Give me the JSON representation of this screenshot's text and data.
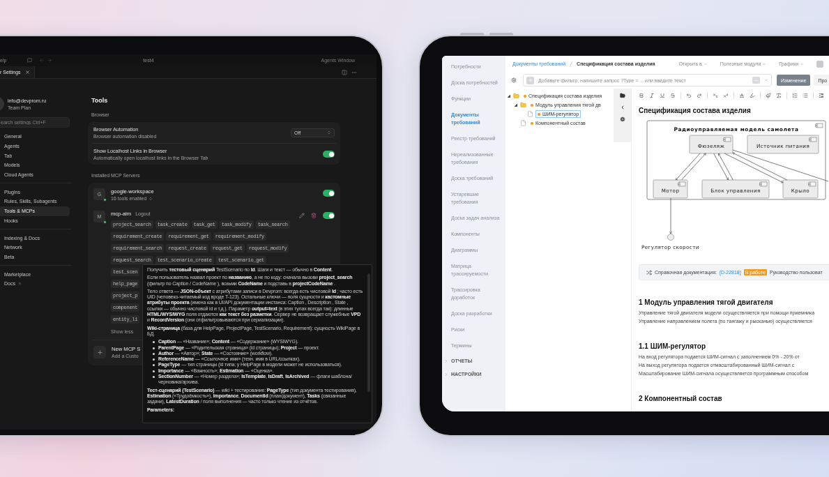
{
  "left_tablet": {
    "title_bar": {
      "menu": "elp",
      "title": "test4",
      "right_label": "Agents Window"
    },
    "tabs": [
      {
        "label": "r Settings",
        "selected": true
      }
    ],
    "sidebar": {
      "account": {
        "email": "info@devprom.ru",
        "plan": "Team Plan"
      },
      "search": {
        "placeholder": "earch settings Ctrl+F"
      },
      "groups": [
        [
          {
            "label": "General",
            "selected": false,
            "external": false
          },
          {
            "label": "Agents",
            "selected": false,
            "external": false
          },
          {
            "label": "Tab",
            "selected": false,
            "external": false
          },
          {
            "label": "Models",
            "selected": false,
            "external": false
          },
          {
            "label": "Cloud Agents",
            "selected": false,
            "external": false
          }
        ],
        [
          {
            "label": "Plugins",
            "selected": false,
            "external": false
          },
          {
            "label": "Rules, Skills, Subagents",
            "selected": false,
            "external": false
          },
          {
            "label": "Tools & MCPs",
            "selected": true,
            "external": false
          },
          {
            "label": "Hooks",
            "selected": false,
            "external": false
          }
        ],
        [
          {
            "label": "Indexing & Docs",
            "selected": false,
            "external": false
          },
          {
            "label": "Network",
            "selected": false,
            "external": false
          },
          {
            "label": "Beta",
            "selected": false,
            "external": false
          }
        ],
        [
          {
            "label": "Marketplace",
            "selected": false,
            "external": false
          },
          {
            "label": "Docs",
            "selected": false,
            "external": true
          }
        ]
      ]
    },
    "tools": {
      "title": "Tools",
      "browser": {
        "heading": "Browser",
        "settings": [
          {
            "kind": "select",
            "title": "Browser Automation",
            "description": "Browser automation disabled",
            "value": "Off"
          },
          {
            "kind": "toggle",
            "title": "Show Localhost Links in Browser",
            "description": "Automatically open localhost links in the Browser Tab",
            "on": true
          }
        ]
      },
      "mcp": {
        "heading": "Installed MCP Servers",
        "servers": [
          {
            "initial": "G",
            "name": "google-workspace",
            "status": "16 tools enabled",
            "connected": true,
            "on": true
          },
          {
            "initial": "M",
            "name": "mcp-alm",
            "action": "Logout",
            "connected": true,
            "on": true,
            "tool_rows": [
              [
                "project_search",
                "task_create",
                "task_get",
                "task_modify",
                "task_search"
              ],
              [
                "requirement_create",
                "requirement_get",
                "requirement_modify"
              ],
              [
                "requirement_search",
                "request_create",
                "request_get",
                "request_modify"
              ],
              [
                "request_search",
                "test_scenario_create",
                "test_scenario_get"
              ],
              [
                "test_scen"
              ],
              [
                "help_page"
              ],
              [
                "project_p"
              ],
              [
                "component"
              ],
              [
                "entity_li"
              ]
            ],
            "toggle_list": "Show less"
          }
        ],
        "new_server": {
          "title": "New MCP S",
          "subtitle": "Add a Custo"
        }
      }
    },
    "tooltip": {
      "blocks": [
        {
          "kind": "p",
          "text": "Получить **тестовый сценарий** TestScenario по **Id**. Шаги и текст — обычно в **Content**."
        },
        {
          "kind": "p",
          "text": "Если пользователь назвал проект по **названию**, а не по коду: сначала вызови **project_search** (фильтр по Caption / CodeName ), возьми **CodeName** и подставь в **projectCodeName** ."
        },
        {
          "kind": "p",
          "text": "Тело ответа — **JSON-объект** с атрибутами записи в Devprom: всегда есть числовой **Id** ; часто есть UID (человеко-читаемый код вроде T-123). Остальные ключи — поля сущности и **кастомные атрибуты проекта** (имена как в UI/API документации инстанса: Caption , Description , State , ссылки — обычно числовой id и т.д.). Параметр **output=text** (в этих тулах всегда так): длинные **HTML/WYSIWYG** поля отдаются **как текст без разметки**. Сервер не возвращает служебные **VPD** и **RecordVersion** (они отфильтровываются при сериализации)."
        },
        {
          "kind": "p",
          "text": "**Wiki-страница** (база для HelpPage, ProjectPage, TestScenario, Requirement): сущность WikiPage в БД."
        },
        {
          "kind": "list",
          "items": [
            "**Caption** — «Название»; **Content** — «Содержание» (WYSIWYG).",
            "**ParentPage** — «Родительская страница» (id страницы); **Project** — проект.",
            "**Author** — «Автор»; **State** — «Состояние» (workflow).",
            "**ReferenceName** — «Ссылочное имя» (техн. имя в URL/ссылках).",
            "**PageType** — тип страницы (id типа; у HelpPage в модели может не использоваться).",
            "**Importance** — «Важность»; **Estimation** — «Оценка».",
            "**SectionNumber** — «Номер раздела»; **IsTemplate**, **IsDraft**, **IsArchived** — флаги шаблона/черновика/архива."
          ]
        },
        {
          "kind": "p",
          "text": "**Тест-сценарий (TestScenario)** — wiki + тестирование: **PageType** (тип документа тестирования), **Estimation** («Трудоёмкость»), **Importance**, **DocumentId** (план/документ), **Tasks** (связанные задачи), **LatestDuration** / поля выполнения — часто только чтение из отчётов."
        },
        {
          "kind": "heading",
          "text": "Parameters:"
        }
      ]
    }
  },
  "right_tablet": {
    "sidebar": {
      "items": [
        {
          "label": "Потребности",
          "selected": false
        },
        {
          "label": "Доска потребностей",
          "selected": false
        },
        {
          "label": "Функции",
          "selected": false
        },
        {
          "label": "Документы требований",
          "selected": true
        },
        {
          "label": "Реестр требований",
          "selected": false
        },
        {
          "label": "Нереализованные требования",
          "selected": false
        },
        {
          "label": "Доска требований",
          "selected": false
        },
        {
          "label": "Устаревшие требования",
          "selected": false
        },
        {
          "label": "Доска задач анализа",
          "selected": false
        },
        {
          "label": "Компоненты",
          "selected": false
        },
        {
          "label": "Диаграммы",
          "selected": false
        },
        {
          "label": "Матрица трассируемости",
          "selected": false
        },
        {
          "label": "Трассировка доработок",
          "selected": false
        },
        {
          "label": "Доска разработки",
          "selected": false
        },
        {
          "label": "Риски",
          "selected": false
        },
        {
          "label": "Термины",
          "selected": false
        }
      ],
      "sections": [
        {
          "label": "ОТЧЕТЫ",
          "expanded": false
        },
        {
          "label": "НАСТРОЙКИ",
          "expanded": false
        }
      ]
    },
    "breadcrumb": {
      "link": "Документы требований",
      "current": "Спецификация состава изделия"
    },
    "menus": [
      "Открыть в",
      "Полезные модули",
      "Графики"
    ],
    "filter": {
      "placeholder": "Добавьте фильтр, напишите запрос ?Type = ... или введите текст"
    },
    "buttons": [
      {
        "label": "Изменение",
        "selected": true
      },
      {
        "label": "Про",
        "selected": false
      }
    ],
    "tree": [
      {
        "label": "Спецификация состава изделия",
        "kind": "folder",
        "expanded": true,
        "selected": false,
        "children": [
          {
            "label": "Модуль управления тягой дв",
            "kind": "folder",
            "expanded": true,
            "selected": false,
            "children": [
              {
                "label": "ШИМ-регулятор",
                "kind": "page",
                "selected": true
              }
            ]
          },
          {
            "label": "Компонентный состав",
            "kind": "page",
            "selected": false
          }
        ]
      }
    ],
    "document": {
      "title": "Спецификация состава изделия",
      "diagram": {
        "title": "Радиоуправляемая модель самолета",
        "nodes": [
          "Фюзеляж",
          "Источник питания",
          "Мотор",
          "Блок управления",
          "Крыло"
        ],
        "interface": "Регулятор скорости"
      },
      "reference": {
        "label": "Справочная документация:",
        "link": "[D-22818]",
        "badge": "В работе",
        "text": "Руководство пользоват"
      },
      "sections": [
        {
          "heading": "1 Модуль управления тягой двигателя",
          "lines": [
            "Управление тягой двигателя модели осуществляется при помощи приемника",
            "Управление направлением полета (по тангажу и рысканью) осуществляется"
          ]
        },
        {
          "heading": "1.1 ШИМ-регулятор",
          "lines": [
            "На вход регулятора подается ШИМ-сигнал с заполнением 0% - 20% от",
            "На выход регулятора подается отмасштабированный ШИМ-сигнал с",
            "Масштабирование ШИМ-сигнала осуществляется программным способом"
          ]
        },
        {
          "heading": "2 Компонентный состав"
        }
      ]
    }
  }
}
